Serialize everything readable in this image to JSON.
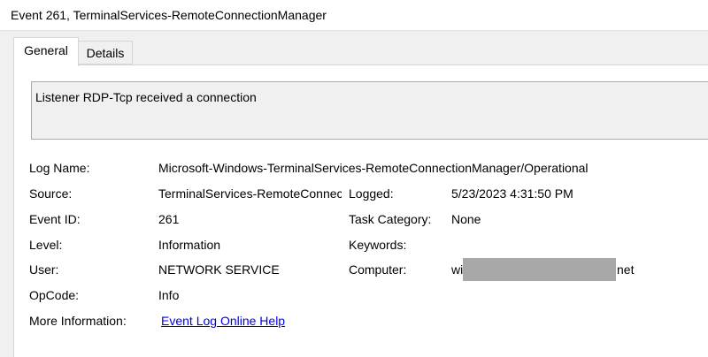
{
  "window": {
    "title": "Event 261, TerminalServices-RemoteConnectionManager"
  },
  "tabs": [
    {
      "label": "General",
      "active": true
    },
    {
      "label": "Details",
      "active": false
    }
  ],
  "message": "Listener RDP-Tcp received a connection",
  "fields": {
    "log_name": {
      "label": "Log Name:",
      "value": "Microsoft-Windows-TerminalServices-RemoteConnectionManager/Operational"
    },
    "source": {
      "label": "Source:",
      "value": "TerminalServices-RemoteConnectionManager"
    },
    "logged": {
      "label": "Logged:",
      "value": "5/23/2023 4:31:50 PM"
    },
    "event_id": {
      "label": "Event ID:",
      "value": "261"
    },
    "task_category": {
      "label": "Task Category:",
      "value": "None"
    },
    "level": {
      "label": "Level:",
      "value": "Information"
    },
    "keywords": {
      "label": "Keywords:",
      "value": ""
    },
    "user": {
      "label": "User:",
      "value": "NETWORK SERVICE"
    },
    "computer": {
      "label": "Computer:",
      "value_prefix": "wi",
      "value_suffix": "net"
    },
    "opcode": {
      "label": "OpCode:",
      "value": "Info"
    },
    "more_info": {
      "label": "More Information:",
      "link": "Event Log Online Help"
    }
  },
  "colors": {
    "link": "#0000ee",
    "redaction": "#a8a8a8"
  }
}
